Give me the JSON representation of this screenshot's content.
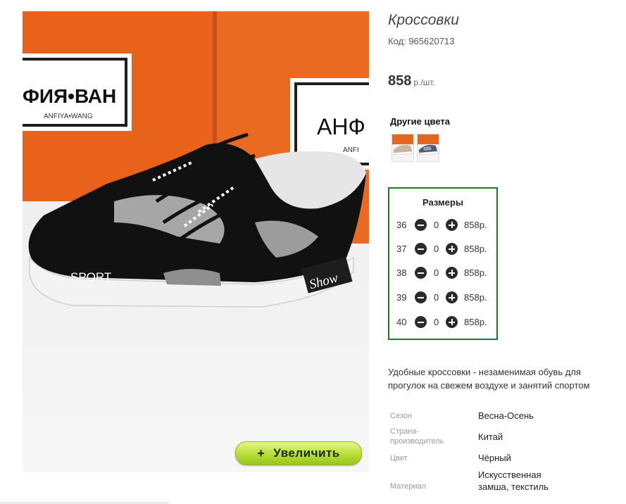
{
  "product": {
    "title": "Кроссовки",
    "code": "Код: 965620713",
    "price": "858",
    "price_unit": "р./шт."
  },
  "image": {
    "box_brand_left": "ФИЯ•ВАН",
    "box_brand_left_sub": "ANFIYA•WANG",
    "box_brand_right": "АНФ",
    "box_brand_right_sub": "ANFI",
    "shoe_text_sport": "SPORT",
    "shoe_text_show": "Show",
    "zoom_button": "Увеличить",
    "zoom_icon": "+"
  },
  "other_colors": {
    "title": "Другие цвета",
    "swatches": [
      "beige-sneaker-thumbnail",
      "grey-blue-sneaker-thumbnail"
    ]
  },
  "sizes": {
    "title": "Размеры",
    "rows": [
      {
        "size": "36",
        "qty": "0",
        "price": "858р."
      },
      {
        "size": "37",
        "qty": "0",
        "price": "858р."
      },
      {
        "size": "38",
        "qty": "0",
        "price": "858р."
      },
      {
        "size": "39",
        "qty": "0",
        "price": "858р."
      },
      {
        "size": "40",
        "qty": "0",
        "price": "858р."
      }
    ]
  },
  "description": "Удобные кроссовки - незаменимая обувь для прогулок на свежем воздухе и занятий спортом",
  "specs": [
    {
      "label": "Сезон",
      "value": "Весна-Осень"
    },
    {
      "label": "Страна-производитель",
      "value": "Китай"
    },
    {
      "label": "Цвет",
      "value": "Чёрный"
    },
    {
      "label": "Материал",
      "value": "Искусственная замша, текстиль"
    }
  ],
  "colors": {
    "sizes_border": "#1b7d1b",
    "zoom_button": "#b7de36",
    "box_orange": "#e8621c"
  }
}
